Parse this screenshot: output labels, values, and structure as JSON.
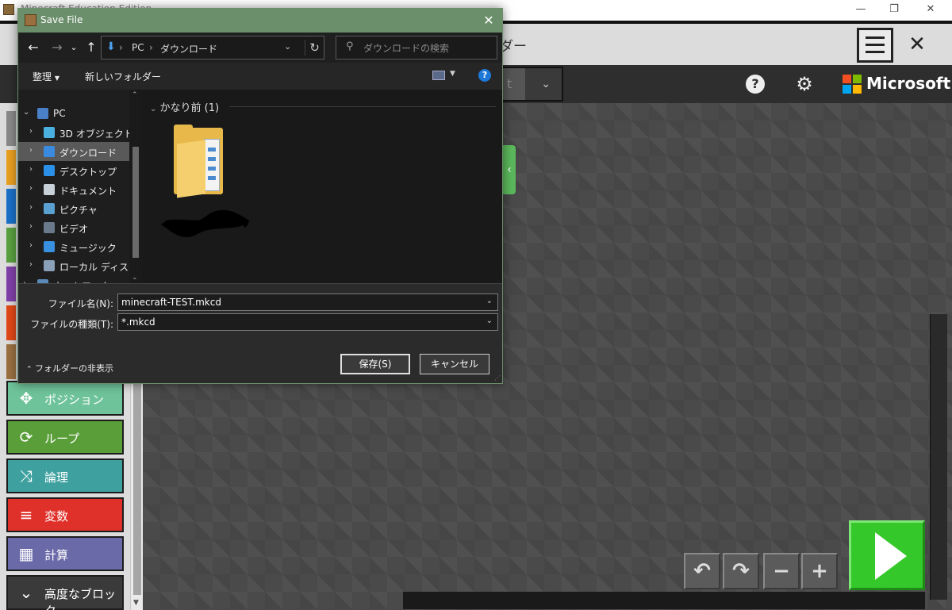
{
  "app": {
    "title": "Minecraft Education Edition",
    "project_name": "ダー",
    "segment_label": "t",
    "ms_text": "Microsoft",
    "ms_logo_colors": [
      "#f25022",
      "#7fba00",
      "#00a4ef",
      "#ffb900"
    ]
  },
  "toolbox": {
    "categories": [
      {
        "label": "ポジション",
        "icon": "position-icon",
        "glyph": "✥",
        "color": "#6ec39a"
      },
      {
        "label": "ループ",
        "icon": "loop-icon",
        "glyph": "⟳",
        "color": "#5a9e3a"
      },
      {
        "label": "論理",
        "icon": "logic-icon",
        "glyph": "⤨",
        "color": "#3fa0a0"
      },
      {
        "label": "変数",
        "icon": "variable-icon",
        "glyph": "≡",
        "color": "#e0302a"
      },
      {
        "label": "計算",
        "icon": "math-icon",
        "glyph": "▦",
        "color": "#6a6aa8"
      },
      {
        "label": "高度なブロック",
        "icon": "chevron-down-icon",
        "glyph": "⌄",
        "color": "#3a3a3a"
      }
    ],
    "hidden_strip_colors": [
      "#8a8a8a",
      "#e8a020",
      "#1a70c8",
      "#5aa040",
      "#8040a8",
      "#e04818",
      "#9a7040"
    ]
  },
  "dialog": {
    "title": "Save File",
    "breadcrumbs": [
      "PC",
      "ダウンロード"
    ],
    "search_placeholder": "ダウンロードの検索",
    "organize_label": "整理",
    "new_folder_label": "新しいフォルダー",
    "tree": [
      {
        "label": "PC",
        "icon": "pc-icon",
        "color": "#4a80c8",
        "level": 0,
        "expanded": true
      },
      {
        "label": "3D オブジェクト",
        "icon": "cube-icon",
        "color": "#4ab0e0",
        "level": 1
      },
      {
        "label": "ダウンロード",
        "icon": "download-icon",
        "color": "#3a8ae0",
        "level": 1,
        "selected": true
      },
      {
        "label": "デスクトップ",
        "icon": "desktop-icon",
        "color": "#2a90e8",
        "level": 1
      },
      {
        "label": "ドキュメント",
        "icon": "document-icon",
        "color": "#c8d0d8",
        "level": 1
      },
      {
        "label": "ピクチャ",
        "icon": "pictures-icon",
        "color": "#5aa0d0",
        "level": 1
      },
      {
        "label": "ビデオ",
        "icon": "video-icon",
        "color": "#6a7a8a",
        "level": 1
      },
      {
        "label": "ミュージック",
        "icon": "music-icon",
        "color": "#3a90e0",
        "level": 1
      },
      {
        "label": "ローカル ディスク (C",
        "icon": "disk-icon",
        "color": "#8aa0b8",
        "level": 1
      },
      {
        "label": "ネットワーク",
        "icon": "network-icon",
        "color": "#5a8ab8",
        "level": 0
      }
    ],
    "group_header": "かなり前 (1)",
    "filename_label": "ファイル名(N):",
    "filename_value": "minecraft-TEST.mkcd",
    "filetype_label": "ファイルの種類(T):",
    "filetype_value": "*.mkcd",
    "hide_folders_label": "フォルダーの非表示",
    "save_label": "保存(S)",
    "cancel_label": "キャンセル",
    "help_glyph": "?"
  }
}
